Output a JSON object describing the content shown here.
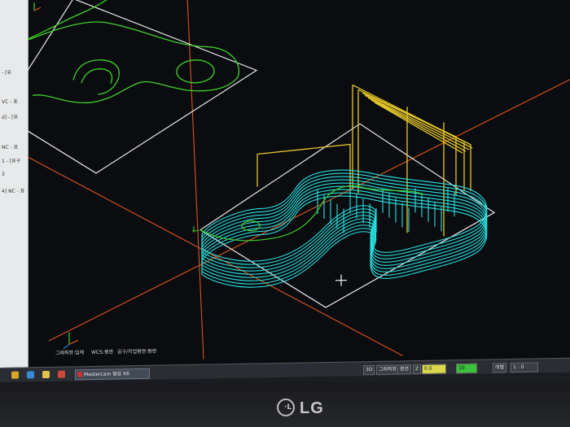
{
  "window": {
    "app_name": "Mastercam 밀링 X6"
  },
  "ops_panel": {
    "items": [
      "- [유",
      "VC - 표",
      "d] - [유",
      "NC - 표",
      "1 - [유구",
      "3",
      "4] NC - 표"
    ]
  },
  "viewport": {
    "status_labels": {
      "graphic_view": "그래픽뷰:입체",
      "wcs": "WCS:평면",
      "tool_plane": "공구/작업평면:평면"
    },
    "toolpath_color_cyan": "#27e0e0",
    "toolpath_color_yellow": "#e6c82a",
    "wireframe_color_green": "#3fd12a",
    "axis_color_orange": "#d9541f"
  },
  "taskbar": {
    "icons": [
      "folder-icon",
      "browser-icon",
      "explorer-icon",
      "media-icon",
      "mastercam-icon"
    ]
  },
  "status_bar": {
    "mode_3d": "3D",
    "graphic_view": "그래픽뷰",
    "plane_label": "평면",
    "z_label": "Z",
    "z_value": "0.0",
    "level_value": "10",
    "layer_label": "레벨",
    "layer_value": "1 : 0"
  },
  "monitor": {
    "brand": "LG"
  }
}
